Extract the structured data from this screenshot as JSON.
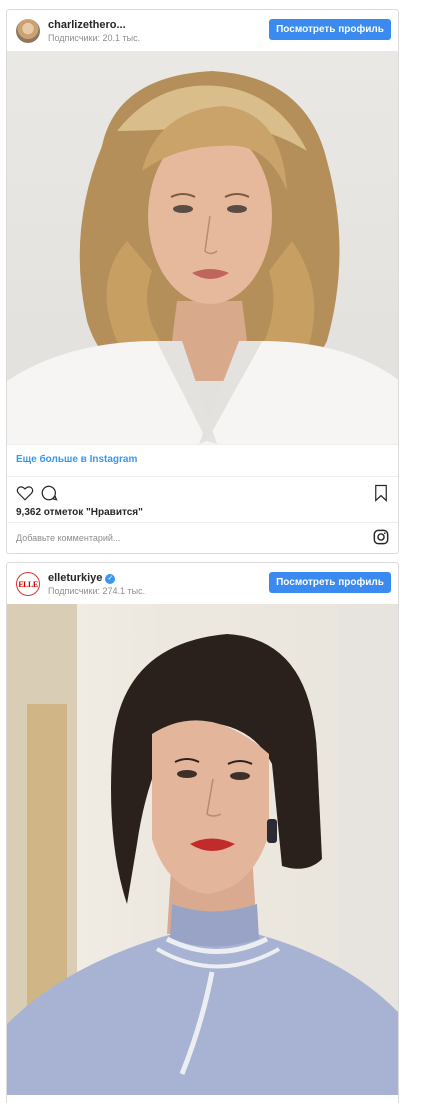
{
  "posts": [
    {
      "username": "charlizethero...",
      "followers": "Подписчики: 20.1 тыс.",
      "profile_button": "Посмотреть профиль",
      "more_link": "Еще больше в Instagram",
      "likes": "9,362 отметок \"Нравится\"",
      "comment_placeholder": "Добавьте комментарий..."
    },
    {
      "username": "elleturkiye",
      "followers": "Подписчики: 274.1 тыс.",
      "profile_button": "Посмотреть профиль",
      "verified": true,
      "avatar_text": "ELLE"
    }
  ],
  "icons": {
    "like": "heart-icon",
    "comment": "comment-icon",
    "save": "bookmark-icon",
    "instagram": "instagram-icon",
    "verified": "verified-badge-icon"
  },
  "colors": {
    "accent": "#3897f0",
    "button": "#3b8af0",
    "border": "#dbdbdb",
    "muted": "#8e8e8e"
  }
}
